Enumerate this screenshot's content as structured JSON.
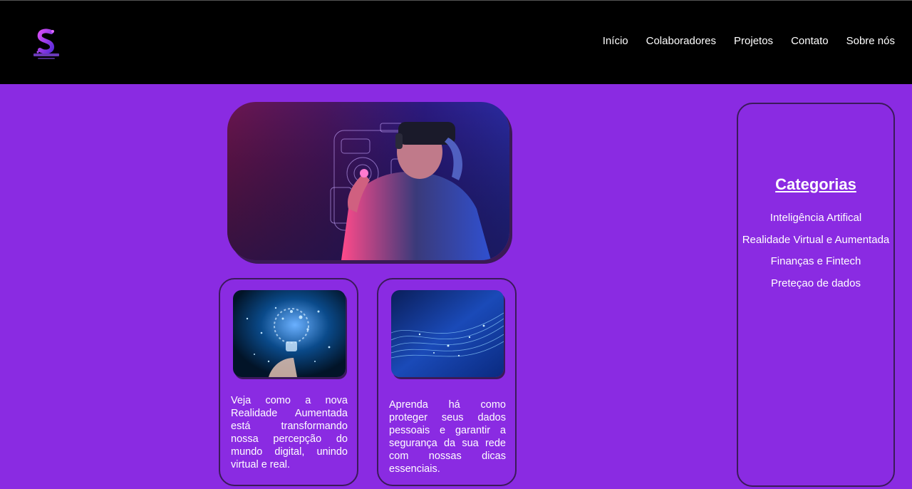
{
  "header": {
    "logo_name": "logo-icon",
    "nav": [
      "Início",
      "Colaboradores",
      "Projetos",
      "Contato",
      "Sobre nós"
    ]
  },
  "cards": [
    {
      "text": "Veja como a nova Realidade Aumentada está transformando nossa percepção do mundo digital, unindo virtual e real."
    },
    {
      "text": "Aprenda há como proteger seus dados pessoais e garantir a segurança da sua rede com nossas dicas essenciais."
    }
  ],
  "sidebar": {
    "title": "Categorias",
    "items": [
      "Inteligência Artifical",
      "Realidade Virtual e Aumentada",
      "Finanças e Fintech",
      "Preteçao de dados"
    ]
  },
  "colors": {
    "page_bg": "#8a2be2",
    "header_bg": "#000000",
    "border": "#3b1a5a",
    "text": "#ffffff"
  }
}
